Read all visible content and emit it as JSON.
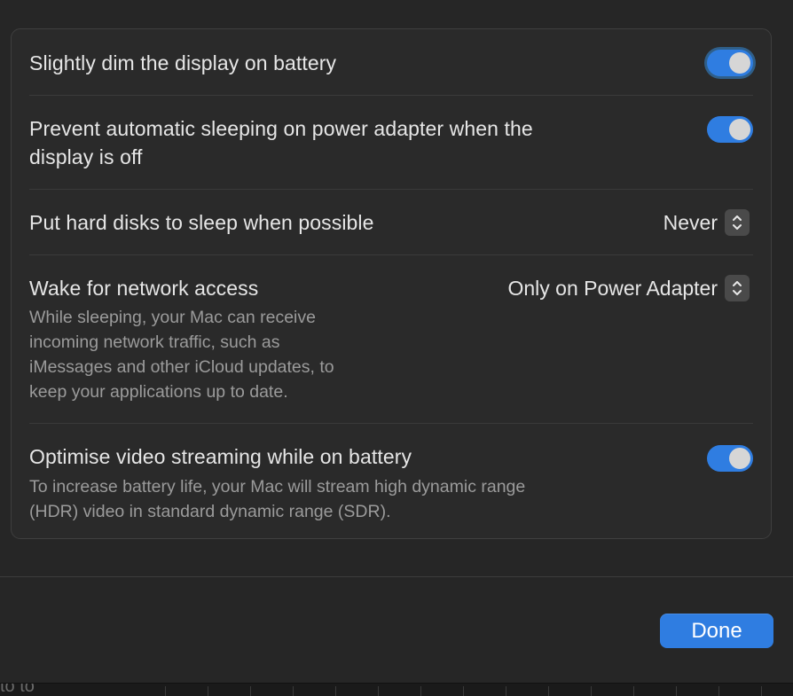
{
  "colors": {
    "accent": "#0a84ff",
    "toggle_on": "#2f7de1",
    "done_button": "#2f7de1",
    "background": "#262626"
  },
  "settings": {
    "dim_display": {
      "title": "Slightly dim the display on battery",
      "enabled": true
    },
    "prevent_sleep": {
      "title_line1": "Prevent automatic sleeping on power adapter when the",
      "title_line2": "display is off",
      "enabled": true
    },
    "hard_disks": {
      "title": "Put hard disks to sleep when possible",
      "value": "Never"
    },
    "wake_network": {
      "title": "Wake for network access",
      "value": "Only on Power Adapter",
      "desc_line1": "While sleeping, your Mac can receive",
      "desc_line2": "incoming network traffic, such as",
      "desc_line3": "iMessages and other iCloud updates, to",
      "desc_line4": "keep your applications up to date."
    },
    "video_streaming": {
      "title": "Optimise video streaming while on battery",
      "enabled": true,
      "desc_line1": "To increase battery life, your Mac will stream high dynamic range",
      "desc_line2": "(HDR) video in standard dynamic range (SDR)."
    }
  },
  "footer": {
    "done_label": "Done"
  },
  "underlay": {
    "partial_text": "to to"
  }
}
